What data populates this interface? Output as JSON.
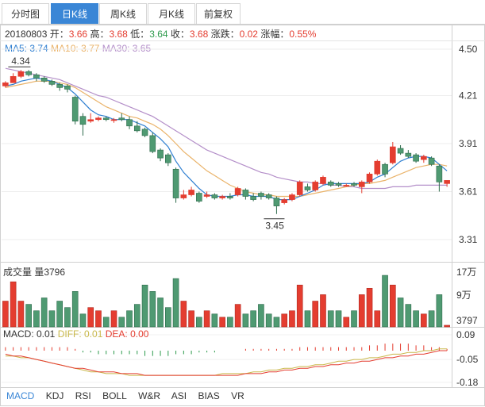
{
  "tabs": [
    "分时图",
    "日K线",
    "周K线",
    "月K线",
    "前复权"
  ],
  "active_tab": 1,
  "info": {
    "date": "20180803",
    "open_label": "开：",
    "open": "3.66",
    "high_label": "高：",
    "high": "3.68",
    "low_label": "低：",
    "low": "3.64",
    "close_label": "收：",
    "close": "3.68",
    "change_label": "涨跌：",
    "change": "0.02",
    "pct_label": "涨幅：",
    "pct": "0.55%"
  },
  "ma": {
    "ma5": "MA5: 3.74",
    "ma10": "MA10: 3.77",
    "ma30": "MA30: 3.65"
  },
  "volume_label": "成交量 量3796",
  "macd": {
    "macd": "MACD: 0.01",
    "diff": "DIFF: 0.01",
    "dea": "DEA: 0.00"
  },
  "indicator_tabs": [
    "MACD",
    "KDJ",
    "RSI",
    "BOLL",
    "W&R",
    "ASI",
    "BIAS",
    "VR"
  ],
  "active_indicator": 0,
  "colors": {
    "up": "#e43d30",
    "down": "#4f9a72",
    "ma5": "#2f7fd1",
    "ma10": "#eab36a",
    "ma30": "#b48fc9",
    "accent": "#3a86d6"
  },
  "chart_data": {
    "type": "candlestick",
    "price_axis": {
      "ticks": [
        "4.50",
        "4.21",
        "3.91",
        "3.61",
        "3.31"
      ],
      "ylim": [
        3.31,
        4.5
      ]
    },
    "volume_axis": {
      "ticks": [
        "17万",
        "9万",
        "3797"
      ]
    },
    "macd_axis": {
      "ticks": [
        "0.09",
        "-0.05",
        "-0.18"
      ]
    },
    "annotations": {
      "max": "4.34",
      "min": "3.45"
    },
    "candles": [
      [
        4.27,
        4.29,
        4.26,
        4.3
      ],
      [
        4.29,
        4.33,
        4.29,
        4.35
      ],
      [
        4.33,
        4.36,
        4.32,
        4.37
      ],
      [
        4.36,
        4.34,
        4.33,
        4.37
      ],
      [
        4.34,
        4.32,
        4.3,
        4.35
      ],
      [
        4.32,
        4.3,
        4.29,
        4.33
      ],
      [
        4.3,
        4.28,
        4.27,
        4.31
      ],
      [
        4.28,
        4.26,
        4.24,
        4.29
      ],
      [
        4.27,
        4.25,
        4.23,
        4.28
      ],
      [
        4.2,
        4.05,
        4.03,
        4.21
      ],
      [
        4.08,
        4.03,
        3.96,
        4.1
      ],
      [
        4.05,
        4.06,
        4.04,
        4.1
      ],
      [
        4.06,
        4.07,
        4.05,
        4.08
      ],
      [
        4.07,
        4.06,
        4.05,
        4.08
      ],
      [
        4.06,
        4.06,
        4.04,
        4.07
      ],
      [
        4.07,
        4.06,
        4.05,
        4.1
      ],
      [
        4.06,
        4.02,
        4.0,
        4.08
      ],
      [
        4.02,
        3.99,
        3.98,
        4.05
      ],
      [
        4.0,
        3.96,
        3.95,
        4.01
      ],
      [
        3.96,
        3.86,
        3.85,
        3.98
      ],
      [
        3.87,
        3.82,
        3.8,
        3.88
      ],
      [
        3.84,
        3.79,
        3.77,
        3.85
      ],
      [
        3.75,
        3.57,
        3.54,
        3.76
      ],
      [
        3.57,
        3.59,
        3.56,
        3.62
      ],
      [
        3.59,
        3.62,
        3.58,
        3.64
      ],
      [
        3.6,
        3.55,
        3.54,
        3.61
      ],
      [
        3.58,
        3.59,
        3.57,
        3.61
      ],
      [
        3.59,
        3.57,
        3.56,
        3.6
      ],
      [
        3.57,
        3.58,
        3.56,
        3.59
      ],
      [
        3.58,
        3.57,
        3.56,
        3.6
      ],
      [
        3.59,
        3.63,
        3.58,
        3.64
      ],
      [
        3.62,
        3.58,
        3.56,
        3.63
      ],
      [
        3.58,
        3.56,
        3.55,
        3.6
      ],
      [
        3.6,
        3.58,
        3.56,
        3.61
      ],
      [
        3.59,
        3.57,
        3.56,
        3.6
      ],
      [
        3.57,
        3.52,
        3.47,
        3.58
      ],
      [
        3.54,
        3.56,
        3.53,
        3.57
      ],
      [
        3.56,
        3.59,
        3.55,
        3.6
      ],
      [
        3.59,
        3.67,
        3.58,
        3.68
      ],
      [
        3.64,
        3.62,
        3.61,
        3.66
      ],
      [
        3.62,
        3.67,
        3.61,
        3.68
      ],
      [
        3.66,
        3.7,
        3.65,
        3.71
      ],
      [
        3.67,
        3.65,
        3.64,
        3.68
      ],
      [
        3.66,
        3.65,
        3.64,
        3.67
      ],
      [
        3.65,
        3.65,
        3.64,
        3.66
      ],
      [
        3.66,
        3.65,
        3.64,
        3.67
      ],
      [
        3.64,
        3.67,
        3.6,
        3.68
      ],
      [
        3.67,
        3.72,
        3.66,
        3.73
      ],
      [
        3.72,
        3.8,
        3.71,
        3.81
      ],
      [
        3.78,
        3.72,
        3.7,
        3.79
      ],
      [
        3.79,
        3.89,
        3.78,
        3.92
      ],
      [
        3.88,
        3.85,
        3.84,
        3.9
      ],
      [
        3.85,
        3.83,
        3.82,
        3.87
      ],
      [
        3.84,
        3.8,
        3.79,
        3.85
      ],
      [
        3.81,
        3.83,
        3.79,
        3.84
      ],
      [
        3.82,
        3.78,
        3.77,
        3.83
      ],
      [
        3.77,
        3.67,
        3.61,
        3.78
      ],
      [
        3.66,
        3.68,
        3.64,
        3.68
      ]
    ],
    "ma5": [
      4.27,
      4.28,
      4.3,
      4.31,
      4.32,
      4.31,
      4.3,
      4.28,
      4.26,
      4.22,
      4.17,
      4.12,
      4.09,
      4.08,
      4.06,
      4.06,
      4.06,
      4.04,
      4.02,
      3.98,
      3.94,
      3.89,
      3.8,
      3.73,
      3.68,
      3.63,
      3.59,
      3.58,
      3.58,
      3.58,
      3.59,
      3.59,
      3.58,
      3.58,
      3.58,
      3.56,
      3.56,
      3.56,
      3.58,
      3.6,
      3.62,
      3.65,
      3.66,
      3.66,
      3.66,
      3.66,
      3.66,
      3.67,
      3.7,
      3.72,
      3.76,
      3.8,
      3.82,
      3.83,
      3.83,
      3.82,
      3.78,
      3.74
    ],
    "ma10": [
      4.26,
      4.27,
      4.28,
      4.29,
      4.3,
      4.3,
      4.3,
      4.29,
      4.28,
      4.26,
      4.23,
      4.2,
      4.17,
      4.14,
      4.12,
      4.1,
      4.08,
      4.07,
      4.05,
      4.03,
      4.0,
      3.96,
      3.91,
      3.86,
      3.82,
      3.78,
      3.74,
      3.71,
      3.68,
      3.65,
      3.63,
      3.61,
      3.6,
      3.59,
      3.59,
      3.58,
      3.58,
      3.58,
      3.58,
      3.59,
      3.6,
      3.61,
      3.62,
      3.63,
      3.64,
      3.65,
      3.66,
      3.66,
      3.67,
      3.68,
      3.7,
      3.72,
      3.74,
      3.76,
      3.77,
      3.78,
      3.78,
      3.77
    ],
    "ma30": [
      4.38,
      4.37,
      4.36,
      4.35,
      4.34,
      4.33,
      4.32,
      4.31,
      4.29,
      4.27,
      4.25,
      4.23,
      4.21,
      4.2,
      4.18,
      4.16,
      4.14,
      4.12,
      4.1,
      4.08,
      4.05,
      4.02,
      3.99,
      3.96,
      3.93,
      3.9,
      3.87,
      3.85,
      3.83,
      3.81,
      3.79,
      3.77,
      3.75,
      3.73,
      3.72,
      3.7,
      3.69,
      3.68,
      3.67,
      3.67,
      3.66,
      3.66,
      3.65,
      3.65,
      3.64,
      3.64,
      3.63,
      3.63,
      3.63,
      3.63,
      3.64,
      3.64,
      3.64,
      3.65,
      3.65,
      3.65,
      3.65,
      3.65
    ],
    "volume": [
      8,
      14,
      8,
      7,
      5,
      9,
      5,
      8,
      6,
      11,
      4,
      6,
      5,
      3,
      5,
      3,
      5,
      7,
      13,
      11,
      9,
      6,
      15,
      8,
      5,
      3,
      5,
      4,
      3,
      3,
      7,
      4,
      5,
      7,
      4,
      3,
      4,
      5,
      13,
      5,
      8,
      10,
      5,
      5,
      3,
      5,
      10,
      12,
      5,
      16,
      13,
      9,
      7,
      5,
      4,
      5,
      10,
      0.5
    ],
    "macd_hist": [
      0.02,
      0.02,
      0.02,
      0.02,
      0.02,
      0.02,
      0.02,
      0.02,
      0.02,
      0.01,
      -0.01,
      -0.01,
      -0.02,
      -0.02,
      -0.02,
      -0.02,
      -0.02,
      -0.02,
      -0.03,
      -0.03,
      -0.03,
      -0.03,
      -0.02,
      -0.02,
      -0.02,
      -0.01,
      -0.01,
      -0.01,
      0.0,
      0.0,
      0.0,
      0.01,
      0.01,
      0.01,
      0.01,
      0.01,
      0.01,
      0.01,
      0.02,
      0.02,
      0.02,
      0.02,
      0.02,
      0.02,
      0.02,
      0.02,
      0.02,
      0.03,
      0.03,
      0.04,
      0.04,
      0.04,
      0.04,
      0.03,
      0.03,
      0.02,
      0.02,
      0.01
    ],
    "diff": [
      -0.03,
      -0.03,
      -0.04,
      -0.04,
      -0.05,
      -0.06,
      -0.07,
      -0.08,
      -0.09,
      -0.1,
      -0.11,
      -0.12,
      -0.12,
      -0.13,
      -0.13,
      -0.13,
      -0.14,
      -0.14,
      -0.14,
      -0.14,
      -0.14,
      -0.14,
      -0.14,
      -0.14,
      -0.14,
      -0.14,
      -0.14,
      -0.14,
      -0.13,
      -0.13,
      -0.13,
      -0.13,
      -0.12,
      -0.12,
      -0.11,
      -0.11,
      -0.1,
      -0.1,
      -0.09,
      -0.09,
      -0.08,
      -0.08,
      -0.07,
      -0.06,
      -0.06,
      -0.05,
      -0.05,
      -0.04,
      -0.04,
      -0.03,
      -0.02,
      -0.02,
      -0.01,
      -0.01,
      0.0,
      0.0,
      0.01,
      0.01
    ],
    "dea": [
      -0.02,
      -0.03,
      -0.03,
      -0.04,
      -0.05,
      -0.06,
      -0.07,
      -0.08,
      -0.09,
      -0.1,
      -0.1,
      -0.11,
      -0.12,
      -0.12,
      -0.12,
      -0.13,
      -0.13,
      -0.13,
      -0.14,
      -0.14,
      -0.14,
      -0.14,
      -0.14,
      -0.14,
      -0.14,
      -0.14,
      -0.14,
      -0.14,
      -0.14,
      -0.14,
      -0.14,
      -0.13,
      -0.13,
      -0.13,
      -0.12,
      -0.12,
      -0.11,
      -0.11,
      -0.1,
      -0.1,
      -0.09,
      -0.09,
      -0.08,
      -0.08,
      -0.07,
      -0.07,
      -0.06,
      -0.06,
      -0.05,
      -0.04,
      -0.04,
      -0.03,
      -0.03,
      -0.02,
      -0.02,
      -0.01,
      0.0,
      0.0
    ]
  }
}
